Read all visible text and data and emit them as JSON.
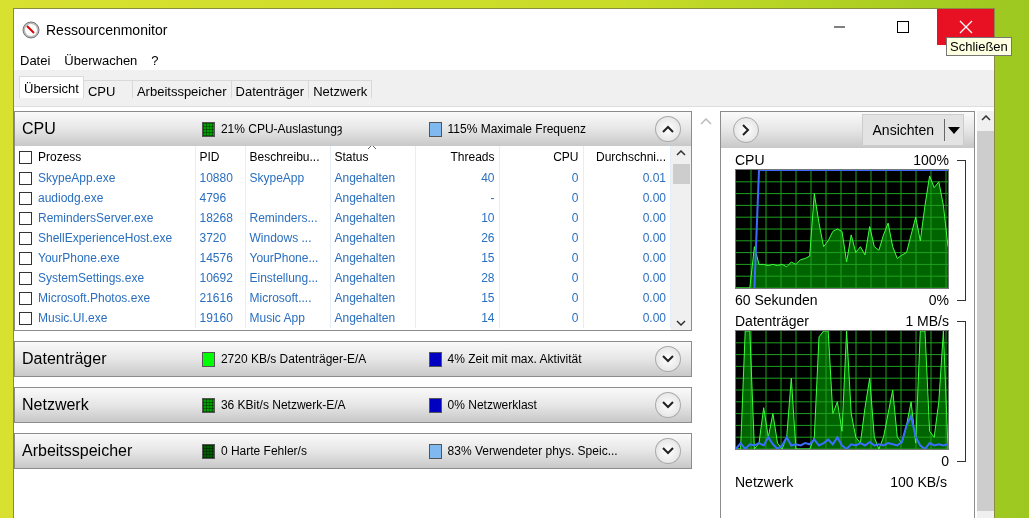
{
  "window": {
    "title": "Ressourcenmonitor",
    "tooltip": "Schließen"
  },
  "menu": [
    "Datei",
    "Überwachen",
    "?"
  ],
  "tabs": [
    {
      "label": "Übersicht",
      "selected": true
    },
    {
      "label": "CPU",
      "selected": false
    },
    {
      "label": "Arbeitsspeicher",
      "selected": false
    },
    {
      "label": "Datenträger",
      "selected": false
    },
    {
      "label": "Netzwerk",
      "selected": false
    }
  ],
  "sections": [
    {
      "title": "CPU",
      "expanded": true,
      "metrics": [
        {
          "text": "21% CPU-Auslastungȝ",
          "color": "#00a000"
        },
        {
          "text": "115% Maximale Frequenz",
          "color": "#80b8f0"
        }
      ]
    },
    {
      "title": "Datenträger",
      "expanded": false,
      "metrics": [
        {
          "text": "2720 KB/s Datenträger-E/A",
          "color": "#00ff00"
        },
        {
          "text": "4% Zeit mit max. Aktivität",
          "color": "#0000c0"
        }
      ]
    },
    {
      "title": "Netzwerk",
      "expanded": false,
      "metrics": [
        {
          "text": "36 KBit/s Netzwerk-E/A",
          "color": "#00a000"
        },
        {
          "text": "0% Netzwerklast",
          "color": "#0000c0"
        }
      ]
    },
    {
      "title": "Arbeitsspeicher",
      "expanded": false,
      "metrics": [
        {
          "text": "0 Harte Fehler/s",
          "color": "#006000"
        },
        {
          "text": "83% Verwendeter phys. Speic...",
          "color": "#80b8f0"
        }
      ]
    }
  ],
  "table": {
    "columns": [
      {
        "label": "Prozess",
        "kind": "text",
        "sorted": false
      },
      {
        "label": "PID",
        "kind": "text",
        "sorted": false
      },
      {
        "label": "Beschreibu...",
        "kind": "text",
        "sorted": false
      },
      {
        "label": "Status",
        "kind": "text",
        "sorted": true
      },
      {
        "label": "Threads",
        "kind": "number",
        "sorted": false
      },
      {
        "label": "CPU",
        "kind": "number",
        "sorted": false
      },
      {
        "label": "Durchschni...",
        "kind": "number",
        "sorted": false
      }
    ],
    "header_checked": false,
    "rows": [
      {
        "checked": false,
        "cells": [
          "SkypeApp.exe",
          "10880",
          "SkypeApp",
          "Angehalten",
          "40",
          "0",
          "0.01"
        ]
      },
      {
        "checked": false,
        "cells": [
          "audiodg.exe",
          "4796",
          "",
          "Angehalten",
          "-",
          "0",
          "0.00"
        ]
      },
      {
        "checked": false,
        "cells": [
          "RemindersServer.exe",
          "18268",
          "Reminders...",
          "Angehalten",
          "10",
          "0",
          "0.00"
        ]
      },
      {
        "checked": false,
        "cells": [
          "ShellExperienceHost.exe",
          "3720",
          "Windows ...",
          "Angehalten",
          "26",
          "0",
          "0.00"
        ]
      },
      {
        "checked": false,
        "cells": [
          "YourPhone.exe",
          "14576",
          "YourPhone...",
          "Angehalten",
          "15",
          "0",
          "0.00"
        ]
      },
      {
        "checked": false,
        "cells": [
          "SystemSettings.exe",
          "10692",
          "Einstellung...",
          "Angehalten",
          "28",
          "0",
          "0.00"
        ]
      },
      {
        "checked": false,
        "cells": [
          "Microsoft.Photos.exe",
          "21616",
          "Microsoft....",
          "Angehalten",
          "15",
          "0",
          "0.00"
        ]
      },
      {
        "checked": false,
        "cells": [
          "Music.UI.exe",
          "19160",
          "Music App",
          "Angehalten",
          "14",
          "0",
          "0.00"
        ]
      }
    ]
  },
  "graphs_panel": {
    "views_button": "Ansichten",
    "graphs": [
      {
        "title": "CPU",
        "max": "100%",
        "footer_left": "60 Sekunden",
        "min": "0%"
      },
      {
        "title": "Datenträger",
        "max": "1 MB/s",
        "min": "0"
      }
    ],
    "next_title": "Netzwerk",
    "next_max": "100 KB/s"
  }
}
